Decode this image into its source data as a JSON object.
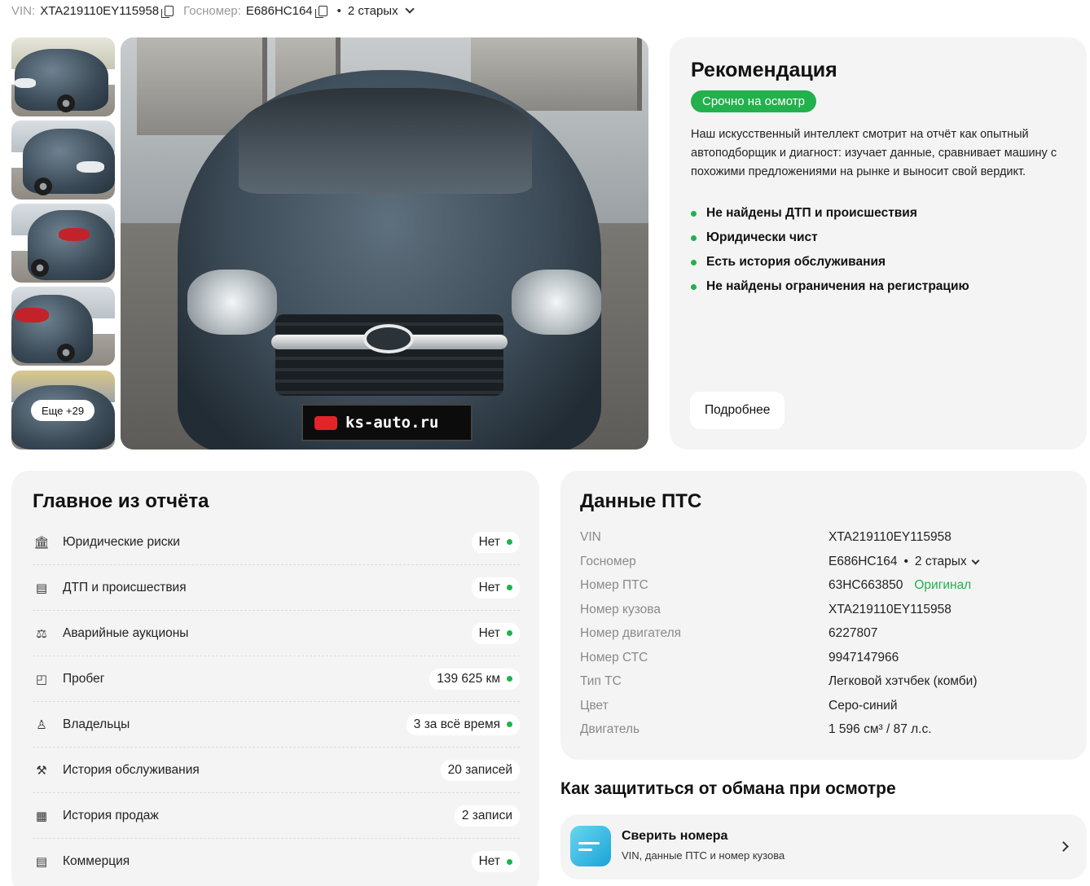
{
  "topbar": {
    "vin_label": "VIN:",
    "vin_value": "XTA219110EY115958",
    "plate_label": "Госномер:",
    "plate_value": "Е686НС164",
    "old_plates": "2 старых",
    "separator": "•"
  },
  "gallery": {
    "more_label": "Еще +29",
    "watermark": "ks-auto.ru"
  },
  "recommendation": {
    "title": "Рекомендация",
    "badge": "Срочно на осмотр",
    "description": "Наш искусственный интеллект смотрит на отчёт как опытный автоподборщик и диагност: изучает данные, сравнивает машину с похожими предложениями на рынке и выносит свой вердикт.",
    "points": [
      "Не найдены ДТП и происшествия",
      "Юридически чист",
      "Есть история обслуживания",
      "Не найдены ограничения на регистрацию"
    ],
    "more_button": "Подробнее"
  },
  "summary": {
    "title": "Главное из отчёта",
    "rows": [
      {
        "icon": "bank-icon",
        "label": "Юридические риски",
        "value": "Нет",
        "ok": true
      },
      {
        "icon": "document-icon",
        "label": "ДТП и происшествия",
        "value": "Нет",
        "ok": true
      },
      {
        "icon": "auction-icon",
        "label": "Аварийные аукционы",
        "value": "Нет",
        "ok": true
      },
      {
        "icon": "chart-icon",
        "label": "Пробег",
        "value": "139 625 км",
        "ok": true
      },
      {
        "icon": "person-icon",
        "label": "Владельцы",
        "value": "3 за всё время",
        "ok": true
      },
      {
        "icon": "wrench-icon",
        "label": "История обслуживания",
        "value": "20 записей",
        "ok": false
      },
      {
        "icon": "receipt-icon",
        "label": "История продаж",
        "value": "2 записи",
        "ok": false
      },
      {
        "icon": "document-icon",
        "label": "Коммерция",
        "value": "Нет",
        "ok": true
      }
    ]
  },
  "pts": {
    "title": "Данные ПТС",
    "rows": [
      {
        "label": "VIN",
        "value": "XTA219110EY115958"
      },
      {
        "label": "Госномер",
        "value": "Е686НС164",
        "extra_sep": "•",
        "extra": "2 старых"
      },
      {
        "label": "Номер ПТС",
        "value": "63НС663850",
        "status": "Оригинал"
      },
      {
        "label": "Номер кузова",
        "value": "XTA219110EY115958"
      },
      {
        "label": "Номер двигателя",
        "value": "6227807"
      },
      {
        "label": "Номер СТС",
        "value": "9947147966"
      },
      {
        "label": "Тип ТС",
        "value": "Легковой хэтчбек (комби)"
      },
      {
        "label": "Цвет",
        "value": "Серо-синий"
      },
      {
        "label": "Двигатель",
        "value": "1 596 см³ / 87 л.с."
      }
    ]
  },
  "protect": {
    "title": "Как защититься от обмана при осмотре",
    "card_title": "Сверить номера",
    "card_sub": "VIN, данные ПТС и номер кузова"
  },
  "colors": {
    "accent_green": "#22b14c",
    "card_bg": "#f4f4f4"
  }
}
